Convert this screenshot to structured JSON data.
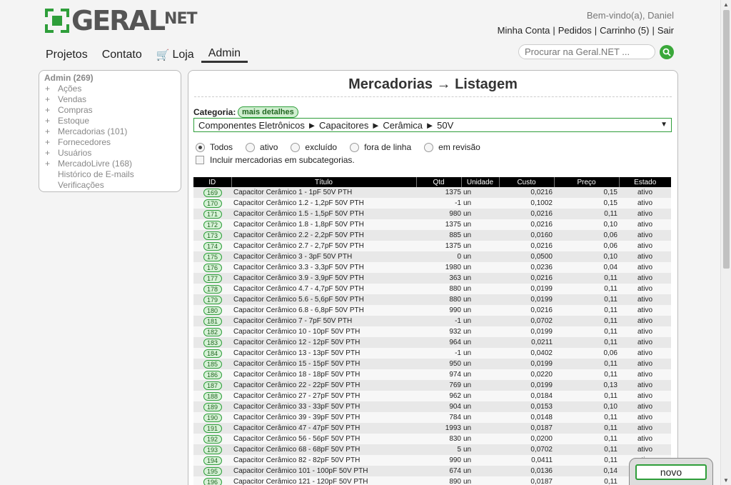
{
  "header": {
    "logo_main": "GERAL",
    "logo_suffix": "NET",
    "welcome": "Bem-vindo(a), Daniel",
    "links": [
      "Minha Conta",
      "Pedidos",
      "Carrinho (5)",
      "Sair"
    ]
  },
  "nav": {
    "items": [
      "Projetos",
      "Contato",
      "Loja",
      "Admin"
    ],
    "active": "Admin"
  },
  "search": {
    "placeholder": "Procurar na Geral.NET ..."
  },
  "sidebar": {
    "title": "Admin (269)",
    "items": [
      {
        "plus": "+",
        "label": "Ações"
      },
      {
        "plus": "+",
        "label": "Vendas"
      },
      {
        "plus": "+",
        "label": "Compras"
      },
      {
        "plus": "+",
        "label": "Estoque"
      },
      {
        "plus": "+",
        "label": "Mercadorias (101)"
      },
      {
        "plus": "+",
        "label": "Fornecedores"
      },
      {
        "plus": "+",
        "label": "Usuários"
      },
      {
        "plus": "+",
        "label": "MercadoLivre (168)"
      },
      {
        "plus": "",
        "label": "Histórico de E-mails"
      },
      {
        "plus": "",
        "label": "Verificações"
      }
    ]
  },
  "main": {
    "title": "Mercadorias → Listagem",
    "category_label": "Categoria:",
    "details_badge": "mais detalhes",
    "category_path": "Componentes Eletrônicos ► Capacitores ► Cerâmica ► 50V",
    "status_filter": {
      "options": [
        "Todos",
        "ativo",
        "excluído",
        "fora de linha",
        "em revisão"
      ],
      "selected": "Todos"
    },
    "include_subcategories": {
      "label": "Incluir mercadorias em subcategorias.",
      "checked": false
    }
  },
  "table": {
    "columns": [
      "ID",
      "Título",
      "Qtd",
      "Unidade",
      "Custo",
      "Preço",
      "Estado"
    ],
    "rows": [
      [
        "169",
        "Capacitor Cerâmico 1 - 1pF 50V PTH",
        "1375",
        "un",
        "0,0216",
        "0,15",
        "ativo"
      ],
      [
        "170",
        "Capacitor Cerâmico 1.2 - 1,2pF 50V PTH",
        "-1",
        "un",
        "0,1002",
        "0,15",
        "ativo"
      ],
      [
        "171",
        "Capacitor Cerâmico 1.5 - 1,5pF 50V PTH",
        "980",
        "un",
        "0,0216",
        "0,11",
        "ativo"
      ],
      [
        "172",
        "Capacitor Cerâmico 1.8 - 1,8pF 50V PTH",
        "1375",
        "un",
        "0,0216",
        "0,10",
        "ativo"
      ],
      [
        "173",
        "Capacitor Cerâmico 2.2 - 2,2pF 50V PTH",
        "885",
        "un",
        "0,0160",
        "0,06",
        "ativo"
      ],
      [
        "174",
        "Capacitor Cerâmico 2.7 - 2,7pF 50V PTH",
        "1375",
        "un",
        "0,0216",
        "0,06",
        "ativo"
      ],
      [
        "175",
        "Capacitor Cerâmico 3 - 3pF 50V PTH",
        "0",
        "un",
        "0,0500",
        "0,10",
        "ativo"
      ],
      [
        "176",
        "Capacitor Cerâmico 3.3 - 3,3pF 50V PTH",
        "1980",
        "un",
        "0,0236",
        "0,04",
        "ativo"
      ],
      [
        "177",
        "Capacitor Cerâmico 3.9 - 3,9pF 50V PTH",
        "363",
        "un",
        "0,0216",
        "0,11",
        "ativo"
      ],
      [
        "178",
        "Capacitor Cerâmico 4.7 - 4,7pF 50V PTH",
        "880",
        "un",
        "0,0199",
        "0,11",
        "ativo"
      ],
      [
        "179",
        "Capacitor Cerâmico 5.6 - 5,6pF 50V PTH",
        "880",
        "un",
        "0,0199",
        "0,11",
        "ativo"
      ],
      [
        "180",
        "Capacitor Cerâmico 6.8 - 6,8pF 50V PTH",
        "990",
        "un",
        "0,0216",
        "0,11",
        "ativo"
      ],
      [
        "181",
        "Capacitor Cerâmico 7 - 7pF 50V PTH",
        "-1",
        "un",
        "0,0702",
        "0,11",
        "ativo"
      ],
      [
        "182",
        "Capacitor Cerâmico 10 - 10pF 50V PTH",
        "932",
        "un",
        "0,0199",
        "0,11",
        "ativo"
      ],
      [
        "183",
        "Capacitor Cerâmico 12 - 12pF 50V PTH",
        "964",
        "un",
        "0,0211",
        "0,11",
        "ativo"
      ],
      [
        "184",
        "Capacitor Cerâmico 13 - 13pF 50V PTH",
        "-1",
        "un",
        "0,0402",
        "0,06",
        "ativo"
      ],
      [
        "185",
        "Capacitor Cerâmico 15 - 15pF 50V PTH",
        "950",
        "un",
        "0,0199",
        "0,11",
        "ativo"
      ],
      [
        "186",
        "Capacitor Cerâmico 18 - 18pF 50V PTH",
        "974",
        "un",
        "0,0220",
        "0,11",
        "ativo"
      ],
      [
        "187",
        "Capacitor Cerâmico 22 - 22pF 50V PTH",
        "769",
        "un",
        "0,0199",
        "0,13",
        "ativo"
      ],
      [
        "188",
        "Capacitor Cerâmico 27 - 27pF 50V PTH",
        "962",
        "un",
        "0,0184",
        "0,11",
        "ativo"
      ],
      [
        "189",
        "Capacitor Cerâmico 33 - 33pF 50V PTH",
        "904",
        "un",
        "0,0153",
        "0,10",
        "ativo"
      ],
      [
        "190",
        "Capacitor Cerâmico 39 - 39pF 50V PTH",
        "784",
        "un",
        "0,0148",
        "0,11",
        "ativo"
      ],
      [
        "191",
        "Capacitor Cerâmico 47 - 47pF 50V PTH",
        "1993",
        "un",
        "0,0187",
        "0,11",
        "ativo"
      ],
      [
        "192",
        "Capacitor Cerâmico 56 - 56pF 50V PTH",
        "830",
        "un",
        "0,0200",
        "0,11",
        "ativo"
      ],
      [
        "193",
        "Capacitor Cerâmico 68 - 68pF 50V PTH",
        "5",
        "un",
        "0,0702",
        "0,11",
        "ativo"
      ],
      [
        "194",
        "Capacitor Cerâmico 82 - 82pF 50V PTH",
        "990",
        "un",
        "0,0411",
        "0,11",
        "ativo"
      ],
      [
        "195",
        "Capacitor Cerâmico 101 - 100pF 50V PTH",
        "674",
        "un",
        "0,0136",
        "0,14",
        "ativo"
      ],
      [
        "196",
        "Capacitor Cerâmico 121 - 120pF 50V PTH",
        "890",
        "un",
        "0,0187",
        "0,11",
        "ativo"
      ]
    ]
  },
  "actions": {
    "new_label": "novo"
  },
  "colors": {
    "accent": "#2e9e3a",
    "header_bg": "#000000"
  }
}
